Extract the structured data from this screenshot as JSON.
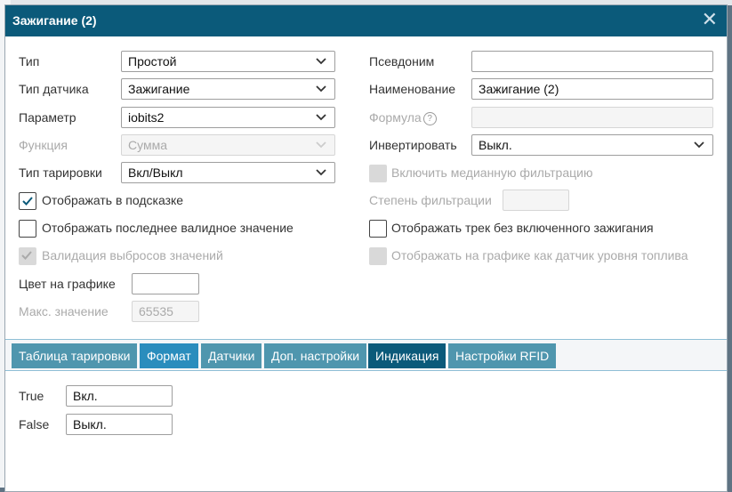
{
  "dialog": {
    "title": "Зажигание (2)"
  },
  "form": {
    "type_label": "Тип",
    "type_value": "Простой",
    "sensor_type_label": "Тип датчика",
    "sensor_type_value": "Зажигание",
    "param_label": "Параметр",
    "param_value": "iobits2",
    "function_label": "Функция",
    "function_value": "Сумма",
    "calib_type_label": "Тип тарировки",
    "calib_type_value": "Вкл/Выкл",
    "alias_label": "Псевдоним",
    "alias_value": "",
    "name_label": "Наименование",
    "name_value": "Зажигание (2)",
    "formula_label": "Формула",
    "formula_value": "",
    "invert_label": "Инвертировать",
    "invert_value": "Выкл.",
    "show_tooltip_label": "Отображать в подсказке",
    "show_last_valid_label": "Отображать последнее валидное значение",
    "validate_outliers_label": "Валидация выбросов значений",
    "median_filter_label": "Включить медианную фильтрацию",
    "filter_degree_label": "Степень фильтрации",
    "filter_degree_value": "",
    "show_track_label": "Отображать трек без включенного зажигания",
    "show_as_fuel_label": "Отображать на графике как датчик уровня топлива",
    "chart_color_label": "Цвет на графике",
    "chart_color_value": "",
    "max_value_label": "Макс. значение",
    "max_value_placeholder": "65535",
    "show_tooltip_checked": true,
    "show_last_valid_checked": false,
    "validate_outliers_checked": true,
    "median_filter_checked": false,
    "show_track_checked": false,
    "show_as_fuel_checked": false
  },
  "tabs": [
    {
      "label": "Таблица тарировки"
    },
    {
      "label": "Формат"
    },
    {
      "label": "Датчики"
    },
    {
      "label": "Доп. настройки"
    },
    {
      "label": "Индикация"
    },
    {
      "label": "Настройки RFID"
    }
  ],
  "active_tab": "Индикация",
  "indication": {
    "true_label": "True",
    "true_value": "Вкл.",
    "false_label": "False",
    "false_value": "Выкл."
  },
  "colors": {
    "titlebar": "#0b5a7a",
    "tab": "#4f96ae",
    "tab_format": "#2a8dbd",
    "tab_active": "#0b5a7a"
  },
  "icons": [
    "close-icon",
    "chevron-down-icon",
    "help-icon",
    "checkmark-icon"
  ]
}
